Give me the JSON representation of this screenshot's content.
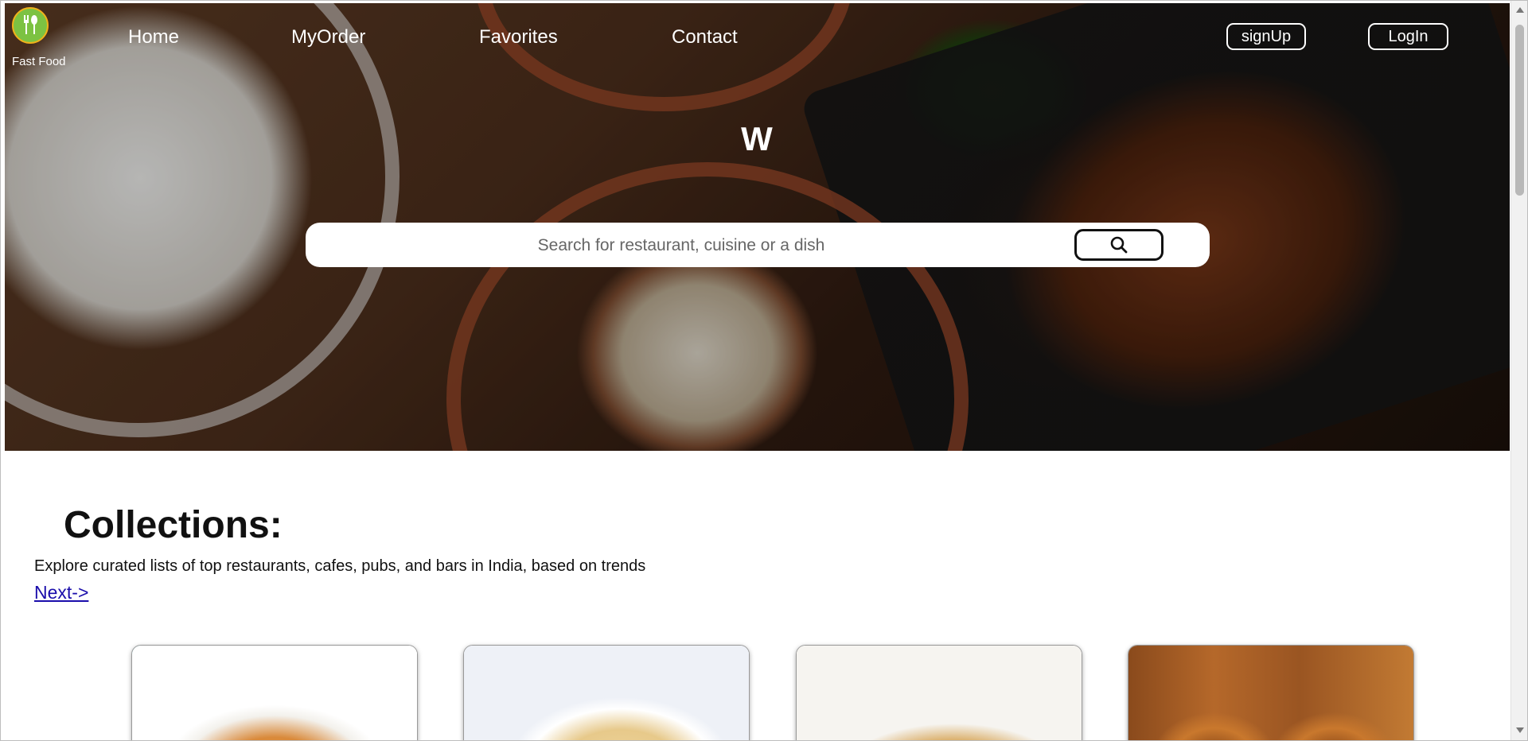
{
  "brand": {
    "name": "Fast Food",
    "logo_icon": "fork-spoon-icon",
    "logo_colors": {
      "fill": "#7cc242",
      "ring": "#f0b21a"
    }
  },
  "nav": {
    "links": [
      "Home",
      "MyOrder",
      "Favorites",
      "Contact"
    ],
    "signup_label": "signUp",
    "login_label": "LogIn"
  },
  "hero": {
    "title": "W"
  },
  "search": {
    "placeholder": "Search for restaurant, cuisine or a dish",
    "value": "",
    "button_icon": "search-icon"
  },
  "collections": {
    "title": "Collections:",
    "description": "Explore curated lists of top restaurants, cafes, pubs, and bars in India, based on trends",
    "next_label": "Next->",
    "cards": [
      {
        "image": "spaghetti-plate"
      },
      {
        "image": "fettuccine-bowl"
      },
      {
        "image": "tagliatelle-pasta"
      },
      {
        "image": "grilled-sandwich"
      }
    ]
  },
  "colors": {
    "link": "#1a0dab",
    "hero_text": "#ffffff"
  }
}
